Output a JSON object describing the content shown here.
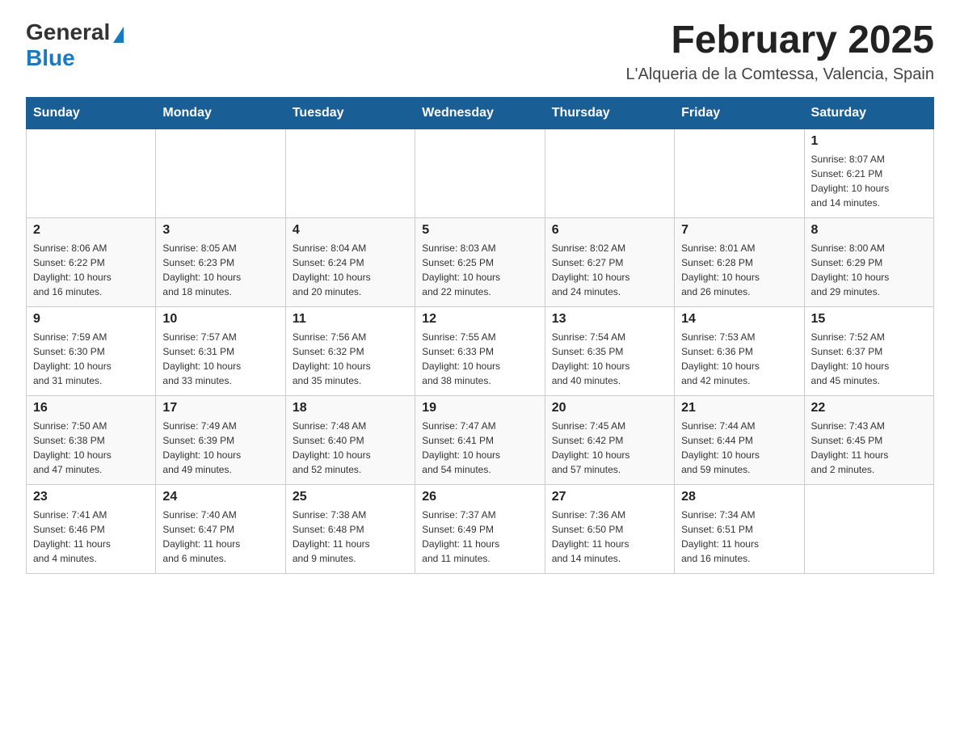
{
  "header": {
    "logo_general": "General",
    "logo_blue": "Blue",
    "month_title": "February 2025",
    "location": "L'Alqueria de la Comtessa, Valencia, Spain"
  },
  "days_of_week": [
    "Sunday",
    "Monday",
    "Tuesday",
    "Wednesday",
    "Thursday",
    "Friday",
    "Saturday"
  ],
  "weeks": [
    {
      "days": [
        {
          "num": "",
          "info": ""
        },
        {
          "num": "",
          "info": ""
        },
        {
          "num": "",
          "info": ""
        },
        {
          "num": "",
          "info": ""
        },
        {
          "num": "",
          "info": ""
        },
        {
          "num": "",
          "info": ""
        },
        {
          "num": "1",
          "info": "Sunrise: 8:07 AM\nSunset: 6:21 PM\nDaylight: 10 hours\nand 14 minutes."
        }
      ]
    },
    {
      "days": [
        {
          "num": "2",
          "info": "Sunrise: 8:06 AM\nSunset: 6:22 PM\nDaylight: 10 hours\nand 16 minutes."
        },
        {
          "num": "3",
          "info": "Sunrise: 8:05 AM\nSunset: 6:23 PM\nDaylight: 10 hours\nand 18 minutes."
        },
        {
          "num": "4",
          "info": "Sunrise: 8:04 AM\nSunset: 6:24 PM\nDaylight: 10 hours\nand 20 minutes."
        },
        {
          "num": "5",
          "info": "Sunrise: 8:03 AM\nSunset: 6:25 PM\nDaylight: 10 hours\nand 22 minutes."
        },
        {
          "num": "6",
          "info": "Sunrise: 8:02 AM\nSunset: 6:27 PM\nDaylight: 10 hours\nand 24 minutes."
        },
        {
          "num": "7",
          "info": "Sunrise: 8:01 AM\nSunset: 6:28 PM\nDaylight: 10 hours\nand 26 minutes."
        },
        {
          "num": "8",
          "info": "Sunrise: 8:00 AM\nSunset: 6:29 PM\nDaylight: 10 hours\nand 29 minutes."
        }
      ]
    },
    {
      "days": [
        {
          "num": "9",
          "info": "Sunrise: 7:59 AM\nSunset: 6:30 PM\nDaylight: 10 hours\nand 31 minutes."
        },
        {
          "num": "10",
          "info": "Sunrise: 7:57 AM\nSunset: 6:31 PM\nDaylight: 10 hours\nand 33 minutes."
        },
        {
          "num": "11",
          "info": "Sunrise: 7:56 AM\nSunset: 6:32 PM\nDaylight: 10 hours\nand 35 minutes."
        },
        {
          "num": "12",
          "info": "Sunrise: 7:55 AM\nSunset: 6:33 PM\nDaylight: 10 hours\nand 38 minutes."
        },
        {
          "num": "13",
          "info": "Sunrise: 7:54 AM\nSunset: 6:35 PM\nDaylight: 10 hours\nand 40 minutes."
        },
        {
          "num": "14",
          "info": "Sunrise: 7:53 AM\nSunset: 6:36 PM\nDaylight: 10 hours\nand 42 minutes."
        },
        {
          "num": "15",
          "info": "Sunrise: 7:52 AM\nSunset: 6:37 PM\nDaylight: 10 hours\nand 45 minutes."
        }
      ]
    },
    {
      "days": [
        {
          "num": "16",
          "info": "Sunrise: 7:50 AM\nSunset: 6:38 PM\nDaylight: 10 hours\nand 47 minutes."
        },
        {
          "num": "17",
          "info": "Sunrise: 7:49 AM\nSunset: 6:39 PM\nDaylight: 10 hours\nand 49 minutes."
        },
        {
          "num": "18",
          "info": "Sunrise: 7:48 AM\nSunset: 6:40 PM\nDaylight: 10 hours\nand 52 minutes."
        },
        {
          "num": "19",
          "info": "Sunrise: 7:47 AM\nSunset: 6:41 PM\nDaylight: 10 hours\nand 54 minutes."
        },
        {
          "num": "20",
          "info": "Sunrise: 7:45 AM\nSunset: 6:42 PM\nDaylight: 10 hours\nand 57 minutes."
        },
        {
          "num": "21",
          "info": "Sunrise: 7:44 AM\nSunset: 6:44 PM\nDaylight: 10 hours\nand 59 minutes."
        },
        {
          "num": "22",
          "info": "Sunrise: 7:43 AM\nSunset: 6:45 PM\nDaylight: 11 hours\nand 2 minutes."
        }
      ]
    },
    {
      "days": [
        {
          "num": "23",
          "info": "Sunrise: 7:41 AM\nSunset: 6:46 PM\nDaylight: 11 hours\nand 4 minutes."
        },
        {
          "num": "24",
          "info": "Sunrise: 7:40 AM\nSunset: 6:47 PM\nDaylight: 11 hours\nand 6 minutes."
        },
        {
          "num": "25",
          "info": "Sunrise: 7:38 AM\nSunset: 6:48 PM\nDaylight: 11 hours\nand 9 minutes."
        },
        {
          "num": "26",
          "info": "Sunrise: 7:37 AM\nSunset: 6:49 PM\nDaylight: 11 hours\nand 11 minutes."
        },
        {
          "num": "27",
          "info": "Sunrise: 7:36 AM\nSunset: 6:50 PM\nDaylight: 11 hours\nand 14 minutes."
        },
        {
          "num": "28",
          "info": "Sunrise: 7:34 AM\nSunset: 6:51 PM\nDaylight: 11 hours\nand 16 minutes."
        },
        {
          "num": "",
          "info": ""
        }
      ]
    }
  ]
}
